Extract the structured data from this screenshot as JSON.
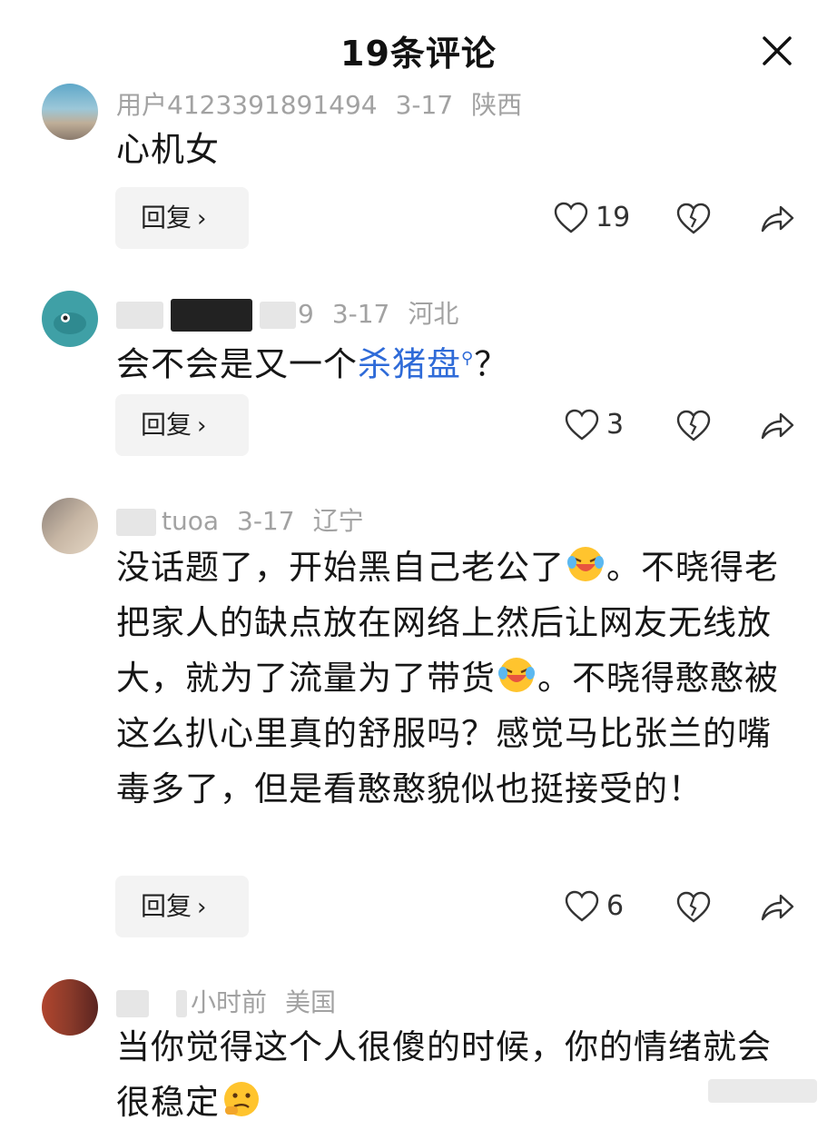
{
  "header": {
    "title": "19条评论"
  },
  "comments": [
    {
      "user": "用户4123391891494",
      "date": "3-17",
      "location": "陕西",
      "text": "心机女",
      "reply_label": "回复",
      "likes": "19"
    },
    {
      "user_partial": "9",
      "date": "3-17",
      "location": "河北",
      "text_before": "会不会是又一个",
      "link": "杀猪盘",
      "text_after": "？",
      "reply_label": "回复",
      "likes": "3"
    },
    {
      "user_partial": "tuoa",
      "date": "3-17",
      "location": "辽宁",
      "text_p1": "没话题了，开始黑自己老公了",
      "text_p2": "。不晓得老把家人的缺点放在网络上然后让网友无线放大，就为了流量为了带货",
      "text_p3": "。不晓得憨憨被这么扒心里真的舒服吗？感觉马比张兰的嘴毒多了，但是看憨憨貌似也挺接受的！",
      "reply_label": "回复",
      "likes": "6"
    },
    {
      "user_partial": "小时前",
      "location": "美国",
      "text": "当你觉得这个人很傻的时候，你的情绪就会很稳定"
    }
  ],
  "icons": {
    "close": "close-icon",
    "like": "heart-icon",
    "dislike": "broken-heart-icon",
    "share": "share-arrow-icon",
    "emoji_laugh": "laugh-cry-emoji-icon",
    "emoji_think": "thinking-emoji-icon"
  },
  "colors": {
    "link": "#2f6bd8",
    "meta": "#a2a2a2",
    "reply_bg": "#f3f3f3"
  }
}
